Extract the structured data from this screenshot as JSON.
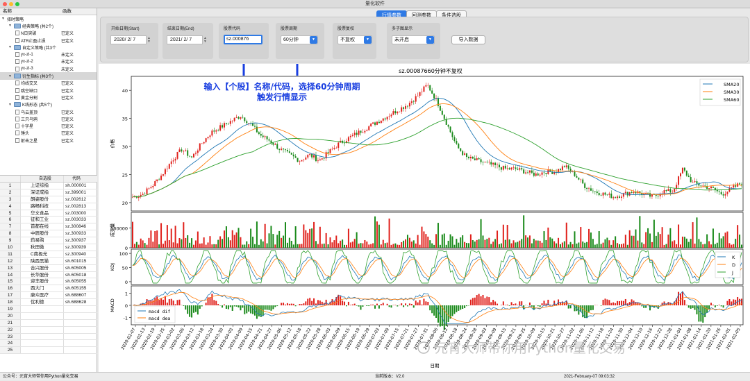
{
  "window": {
    "title": "量化软件"
  },
  "tabs": [
    "行情参数",
    "回测参数",
    "条件选股"
  ],
  "params": {
    "start_label": "开始日期(Start)",
    "start_value": "2020/ 2/ 7",
    "end_label": "结束日期(End)",
    "end_value": "2021/ 2/ 7",
    "code_label": "股票代码",
    "code_value": "sz.000876",
    "period_label": "股票周期",
    "period_value": "60分钟",
    "adjust_label": "股票复权",
    "adjust_value": "不复权",
    "subchart_label": "多子图显示",
    "subchart_value": "未开启",
    "import_button": "导入数据"
  },
  "strategy_tree": {
    "headers": [
      "名称",
      "函数"
    ],
    "rows": [
      {
        "level": 0,
        "name": "择时策略",
        "state": ""
      },
      {
        "level": 1,
        "name": "经典策略 (共2个)",
        "state": ""
      },
      {
        "level": 2,
        "name": "N日突破",
        "state": "已定义"
      },
      {
        "level": 2,
        "name": "ATR止盈止损",
        "state": "已定义"
      },
      {
        "level": 1,
        "name": "自定义策略 (共3个",
        "state": ""
      },
      {
        "level": 2,
        "name": "yx-zl-1",
        "state": "未定义"
      },
      {
        "level": 2,
        "name": "yx-zl-2",
        "state": "未定义"
      },
      {
        "level": 2,
        "name": "yx-zl-3",
        "state": "未定义"
      },
      {
        "level": 1,
        "name": "衍生指标 (共3个)",
        "state": "",
        "selected": true
      },
      {
        "level": 2,
        "name": "均线交叉",
        "state": "已定义"
      },
      {
        "level": 2,
        "name": "跳空缺口",
        "state": "已定义"
      },
      {
        "level": 2,
        "name": "黄金分割",
        "state": "已定义"
      },
      {
        "level": 1,
        "name": "K线形态 (共5个)",
        "state": ""
      },
      {
        "level": 2,
        "name": "乌云盖顶",
        "state": "已定义"
      },
      {
        "level": 2,
        "name": "三只乌鸦",
        "state": "已定义"
      },
      {
        "level": 2,
        "name": "十字星",
        "state": "已定义"
      },
      {
        "level": 2,
        "name": "锤头",
        "state": "已定义"
      },
      {
        "level": 2,
        "name": "射击之星",
        "state": "已定义"
      }
    ]
  },
  "stock_table": {
    "headers": [
      "",
      "自选股",
      "代码"
    ],
    "rows": [
      [
        "1",
        "上证综指",
        "sh.000001"
      ],
      [
        "2",
        "深证成指",
        "sz.399001"
      ],
      [
        "3",
        "朗姿股份",
        "sz.002612"
      ],
      [
        "4",
        "路畅科技",
        "sz.002813"
      ],
      [
        "5",
        "华文食品",
        "sz.003000"
      ],
      [
        "6",
        "征和工业",
        "sz.003033"
      ],
      [
        "7",
        "首都在线",
        "sz.300846"
      ],
      [
        "8",
        "中辰股份",
        "sz.300933"
      ],
      [
        "9",
        "药易购",
        "sz.300937"
      ],
      [
        "10",
        "秋田微",
        "sz.300939"
      ],
      [
        "11",
        "C南极光",
        "sz.300940"
      ],
      [
        "12",
        "陕西黑猫",
        "sh.601015"
      ],
      [
        "13",
        "合兴股份",
        "sh.605005"
      ],
      [
        "14",
        "长华股份",
        "sh.605018"
      ],
      [
        "15",
        "迎丰股份",
        "sh.605055"
      ],
      [
        "16",
        "西大门",
        "sh.605155"
      ],
      [
        "17",
        "康众医疗",
        "sh.688607"
      ],
      [
        "18",
        "优利德",
        "sh.688628"
      ],
      [
        "19",
        "",
        ""
      ],
      [
        "20",
        "",
        ""
      ],
      [
        "21",
        "",
        ""
      ],
      [
        "22",
        "",
        ""
      ],
      [
        "23",
        "",
        ""
      ],
      [
        "24",
        "",
        ""
      ],
      [
        "25",
        "",
        ""
      ]
    ]
  },
  "annotation": {
    "line1": "输入【个股】名称/代码，选择60分钟周期",
    "line2": "触发行情显示"
  },
  "watermark": "元宵大师带你用Python量化交易",
  "status": {
    "left": "公众号：元宵大师带你用Python量化交易",
    "version": "当前版本：V2.0",
    "time": "2021-February-07 09:03:32"
  },
  "colors": {
    "up": "#e0201b",
    "down": "#1a8a1a",
    "sma20": "#1f77b4",
    "sma30": "#ff7f0e",
    "sma60": "#2ca02c",
    "accent": "#2f7ae5"
  },
  "chart_data": {
    "type": "line",
    "title": "sz.00087660分钟不复权",
    "x_ticks": [
      "2020-02-07",
      "2020-02-13",
      "2020-02-19",
      "2020-02-25",
      "2020-03-02",
      "2020-03-06",
      "2020-03-12",
      "2020-03-18",
      "2020-03-24",
      "2020-03-30",
      "2020-04-03",
      "2020-04-09",
      "2020-04-15",
      "2020-04-21",
      "2020-04-27",
      "2020-05-06",
      "2020-05-12",
      "2020-05-18",
      "2020-05-22",
      "2020-05-28",
      "2020-06-03",
      "2020-06-09",
      "2020-06-15",
      "2020-06-19",
      "2020-06-29",
      "2020-07-03",
      "2020-07-09",
      "2020-07-15",
      "2020-07-21",
      "2020-07-27",
      "2020-07-31",
      "2020-08-06",
      "2020-08-12",
      "2020-08-18",
      "2020-08-24",
      "2020-08-28",
      "2020-09-03",
      "2020-09-09",
      "2020-09-15",
      "2020-09-21",
      "2020-09-25",
      "2020-10-09",
      "2020-10-15",
      "2020-10-21",
      "2020-10-27",
      "2020-11-02",
      "2020-11-06",
      "2020-11-12",
      "2020-11-18",
      "2020-11-24",
      "2020-11-30",
      "2020-12-04",
      "2020-12-10",
      "2020-12-16",
      "2020-12-22",
      "2020-12-28",
      "2021-01-04",
      "2021-01-08",
      "2021-01-14",
      "2021-01-20",
      "2021-01-26",
      "2021-02-01",
      "2021-02-05"
    ],
    "price": {
      "ylabel": "价格",
      "yticks": [
        20,
        25,
        30,
        35,
        40
      ],
      "ylim": [
        18.5,
        42.5
      ],
      "close_keypoints": [
        21,
        21.5,
        23,
        25,
        27.5,
        29.5,
        28,
        30.5,
        32.5,
        33.5,
        34.5,
        35.5,
        34,
        32,
        31,
        29.5,
        28.5,
        27.5,
        28.5,
        27.5,
        29,
        30.5,
        31.5,
        32.5,
        33.5,
        34.5,
        35.5,
        36.5,
        37.5,
        39,
        41,
        38,
        34,
        30,
        28,
        27.5,
        27,
        26.5,
        26,
        26,
        25.5,
        25,
        25.5,
        25.5,
        26.5,
        25,
        23,
        22,
        21.5,
        21,
        21.5,
        22,
        21.5,
        21,
        22,
        22,
        26,
        23.5,
        23,
        22.5,
        21.5,
        22.5,
        23.5
      ],
      "legend": [
        "SMA20",
        "SMA30",
        "SMA60"
      ]
    },
    "volume": {
      "ylabel": "成交量",
      "yticks": [
        0,
        500000
      ]
    },
    "kdj": {
      "ylabel": "KDJ",
      "yticks": [
        0,
        50,
        100
      ],
      "legend": [
        "K",
        "D",
        "J"
      ]
    },
    "macd": {
      "ylabel": "MACD",
      "yticks": [
        -1,
        0,
        1
      ],
      "legend": [
        "macd dif",
        "macd dea"
      ]
    },
    "xlabel": "日期"
  }
}
